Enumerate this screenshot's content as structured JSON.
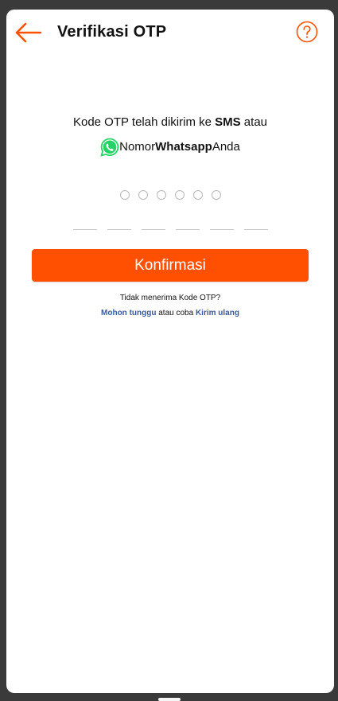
{
  "header": {
    "title": "Verifikasi OTP",
    "back_icon": "arrow-left-icon",
    "help_icon": "question-circle-icon"
  },
  "message": {
    "line1_prefix": "Kode OTP telah dikirim ke ",
    "line1_bold": "SMS",
    "line1_suffix": " atau",
    "line2_icon": "whatsapp-icon",
    "line2_prefix": "Nomor ",
    "line2_bold": "Whatsapp",
    "line2_suffix": " Anda"
  },
  "otp": {
    "length": 6
  },
  "confirm_button": {
    "label": "Konfirmasi"
  },
  "resend": {
    "question": "Tidak menerima Kode OTP?",
    "wait_link": "Mohon tunggu",
    "middle": " atau coba ",
    "resend_link": "Kirim ulang"
  },
  "colors": {
    "accent": "#fe5000",
    "link": "#3c5a9a",
    "whatsapp": "#25d366"
  }
}
